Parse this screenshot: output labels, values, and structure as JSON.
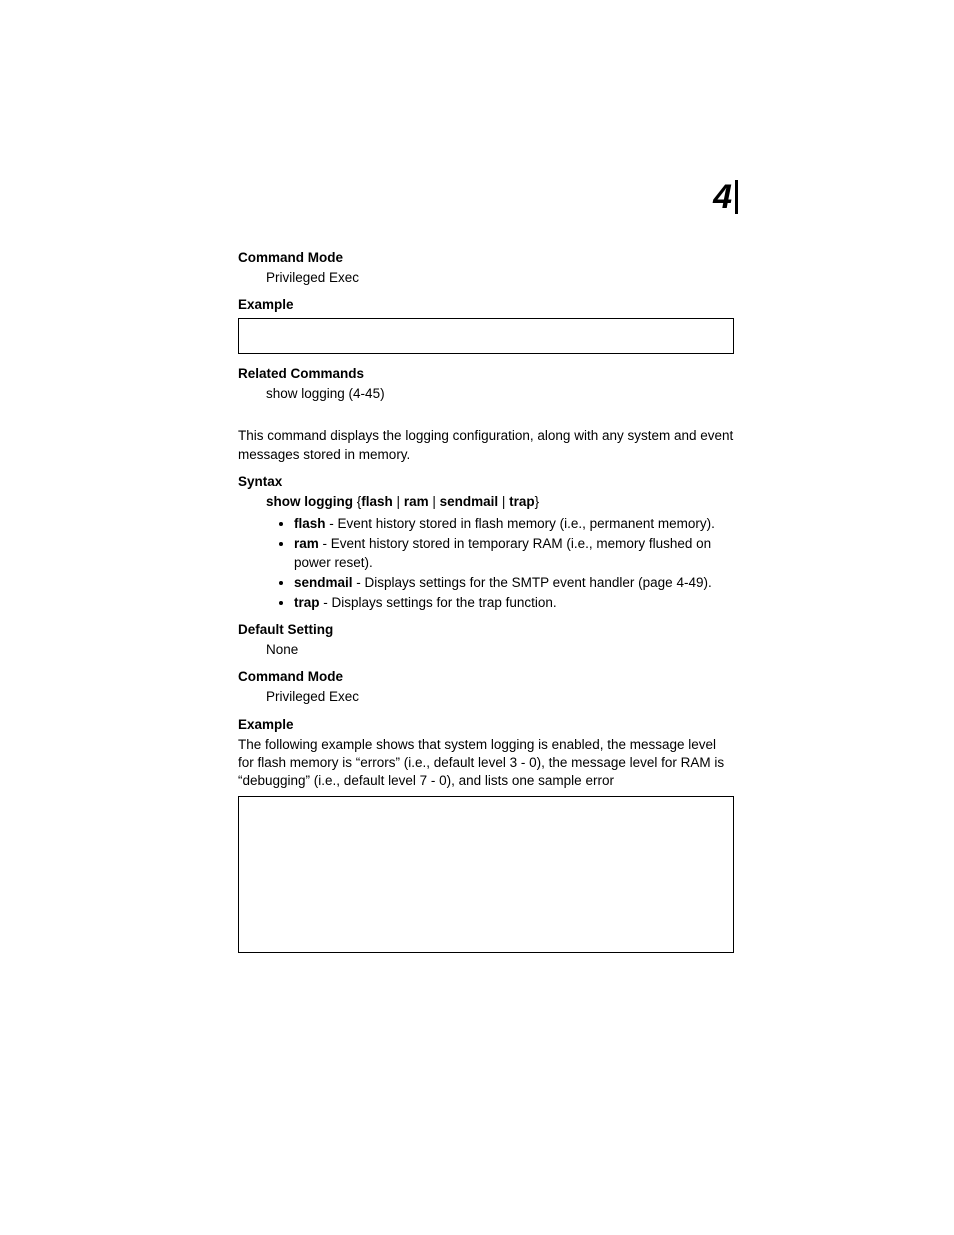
{
  "chapter": "4",
  "sec1": {
    "cmdmode_h": "Command Mode",
    "cmdmode_v": "Privileged Exec",
    "example_h": "Example",
    "related_h": "Related Commands",
    "related_v": "show logging (4-45)"
  },
  "sec2": {
    "intro": "This command displays the logging configuration, along with any system and event messages stored in memory.",
    "syntax_h": "Syntax",
    "syntax_cmd": "show logging",
    "syntax_opt1": "flash",
    "syntax_opt2": "ram",
    "syntax_opt3": "sendmail",
    "syntax_opt4": "trap",
    "lbrace": "{",
    "rbrace": "}",
    "pipe": " | ",
    "bullets": {
      "flash_k": "flash",
      "flash_d": " - Event history stored in flash memory (i.e., permanent memory).",
      "ram_k": "ram",
      "ram_d": " - Event history stored in temporary RAM (i.e., memory flushed on power reset).",
      "sendmail_k": "sendmail",
      "sendmail_d": " - Displays settings for the SMTP event handler (page 4-49).",
      "trap_k": "trap",
      "trap_d": " - Displays settings for the trap function."
    },
    "default_h": "Default Setting",
    "default_v": "None",
    "cmdmode_h": "Command Mode",
    "cmdmode_v": "Privileged Exec",
    "example_h": "Example",
    "example_p": "The following example shows that system logging is enabled, the message level for flash memory is “errors” (i.e., default level 3 - 0), the message level for RAM is “debugging” (i.e., default level 7 - 0), and lists one sample error"
  }
}
